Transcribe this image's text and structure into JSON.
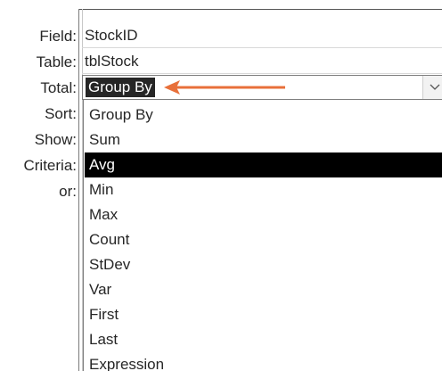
{
  "labels": {
    "field": "Field:",
    "table": "Table:",
    "total": "Total:",
    "sort": "Sort:",
    "show": "Show:",
    "criteria": "Criteria:",
    "or": "or:"
  },
  "column": {
    "field_value": "StockID",
    "table_value": "tblStock",
    "total_value": "Group By"
  },
  "dropdown": {
    "icon": "chevron-down-icon",
    "selected": "Avg",
    "options": [
      "Group By",
      "Sum",
      "Avg",
      "Min",
      "Max",
      "Count",
      "StDev",
      "Var",
      "First",
      "Last",
      "Expression"
    ]
  },
  "annotation": {
    "arrow_color": "#e8703a"
  }
}
